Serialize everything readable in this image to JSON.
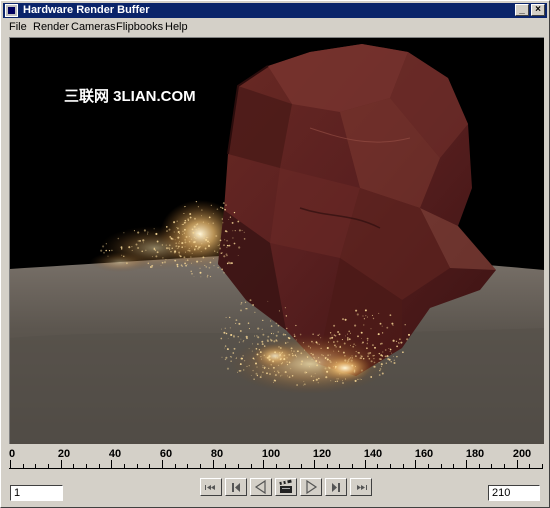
{
  "window": {
    "title": "Hardware Render Buffer",
    "minimize_glyph": "_",
    "close_glyph": "×"
  },
  "menu": {
    "items": [
      "File",
      "Render",
      "Cameras",
      "Flipbooks",
      "Help"
    ]
  },
  "viewport": {
    "watermark": "三联网 3LIAN.COM"
  },
  "timeline": {
    "tick_labels": [
      "0",
      "20",
      "40",
      "60",
      "80",
      "100",
      "120",
      "140",
      "160",
      "180",
      "200"
    ],
    "start_frame": "1",
    "end_frame": "210"
  },
  "playback": {
    "buttons": [
      "rewind-to-start",
      "step-back",
      "play-backward",
      "clapper",
      "play-forward",
      "step-forward",
      "fast-forward-to-end"
    ]
  },
  "colors": {
    "titlebar": "#0a246a",
    "window_face": "#d4d0c8",
    "rock": "#5a2420",
    "ground": "#6f6760",
    "sparks": "#f6d796"
  }
}
